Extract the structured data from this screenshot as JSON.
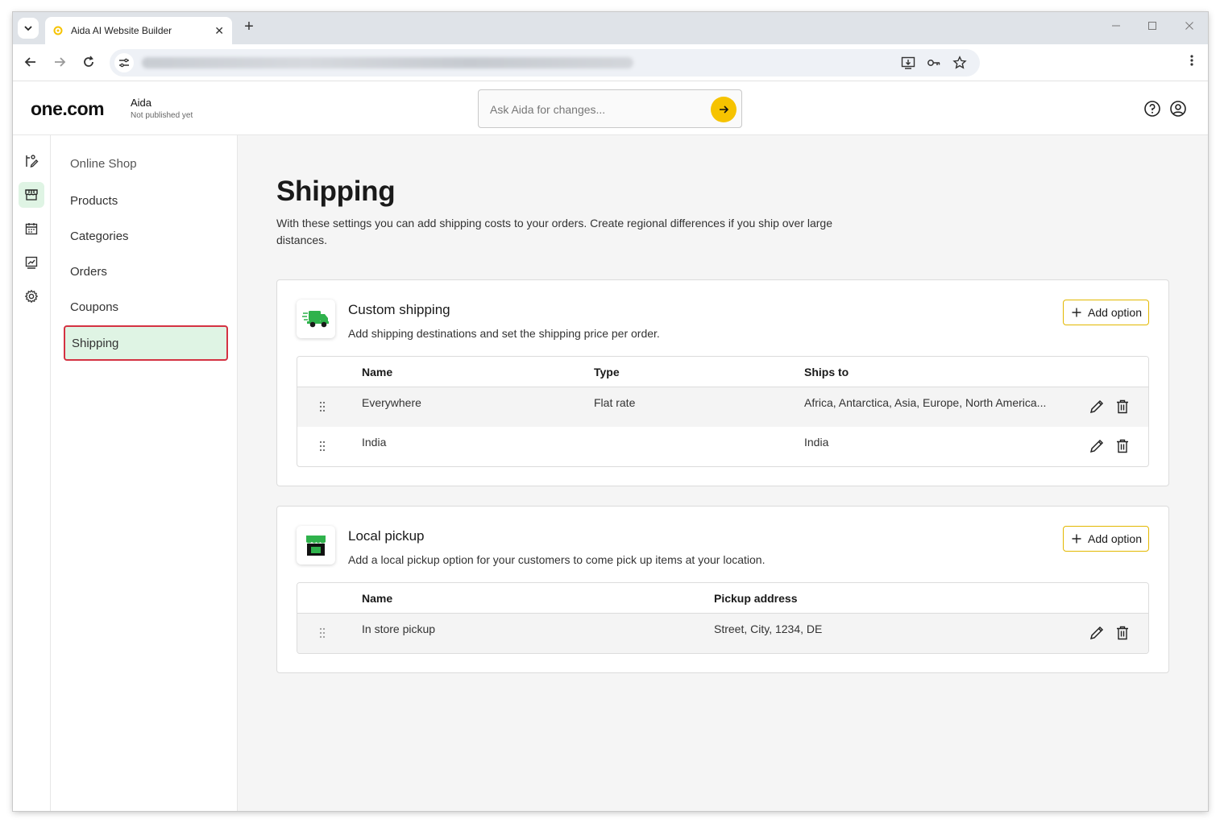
{
  "browser": {
    "tab_title": "Aida AI Website Builder",
    "tab_close": "✕",
    "new_tab": "+"
  },
  "header": {
    "logo": "one.com",
    "site_name": "Aida",
    "site_status": "Not published yet",
    "ask_placeholder": "Ask Aida for changes..."
  },
  "sidebar": {
    "title": "Online Shop",
    "items": [
      {
        "label": "Products"
      },
      {
        "label": "Categories"
      },
      {
        "label": "Orders"
      },
      {
        "label": "Coupons"
      },
      {
        "label": "Shipping",
        "active": true
      }
    ]
  },
  "page": {
    "title": "Shipping",
    "description": "With these settings you can add shipping costs to your orders. Create regional differences if you ship over large distances."
  },
  "custom_shipping": {
    "title": "Custom shipping",
    "subtitle": "Add shipping destinations and set the shipping price per order.",
    "add_label": "Add option",
    "columns": [
      "Name",
      "Type",
      "Ships to"
    ],
    "rows": [
      {
        "name": "Everywhere",
        "type": "Flat rate",
        "ships_to": "Africa, Antarctica, Asia, Europe, North America..."
      },
      {
        "name": "India",
        "type": "",
        "ships_to": "India"
      }
    ]
  },
  "local_pickup": {
    "title": "Local pickup",
    "subtitle": "Add a local pickup option for your customers to come pick up items at your location.",
    "add_label": "Add option",
    "columns": [
      "Name",
      "Pickup address"
    ],
    "rows": [
      {
        "name": "In store pickup",
        "address": "Street, City, 1234, DE"
      }
    ]
  },
  "colors": {
    "accent_yellow": "#f6c300",
    "active_green_bg": "#dff4e4",
    "highlight_red": "#d43242",
    "brand_green": "#2fb24c"
  }
}
